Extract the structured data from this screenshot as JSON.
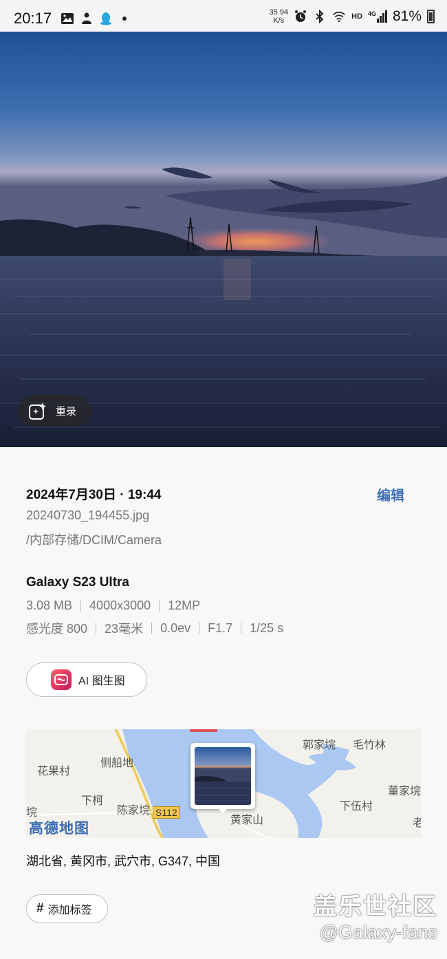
{
  "status_bar": {
    "time": "20:17",
    "net_speed_value": "35.94",
    "net_speed_unit": "K/s",
    "network": "HD",
    "signal": "4G",
    "battery": "81%",
    "icons": [
      "gallery-icon",
      "person-icon",
      "qq-icon",
      "alarm-icon",
      "bluetooth-icon",
      "wifi-icon",
      "signal-icon",
      "battery-icon"
    ]
  },
  "photo": {
    "remaster_label": "重录"
  },
  "details": {
    "datetime": "2024年7月30日 · 19:44",
    "edit_label": "编辑",
    "filename": "20240730_194455.jpg",
    "path": "/内部存储/DCIM/Camera",
    "device": "Galaxy S23 Ultra",
    "specs_row1": [
      "3.08 MB",
      "4000x3000",
      "12MP"
    ],
    "specs_row2": [
      "感光度 800",
      "23毫米",
      "0.0ev",
      "F1.7",
      "1/25 s"
    ],
    "ai_button_label": "AI 图生图"
  },
  "map": {
    "brand": "高德地图",
    "labels": [
      "花果村",
      "侧船地",
      "下柯",
      "陈家垸",
      "郭家垸",
      "毛竹林",
      "董家垸",
      "下伍村",
      "黄家山",
      "垸",
      "老"
    ],
    "road": "S112"
  },
  "location": {
    "address": "湖北省, 黄冈市, 武穴市, G347, 中国"
  },
  "tags": {
    "add_label": "添加标签"
  },
  "watermark": {
    "line1": "盖乐世社区",
    "line2": "@Galaxy-fans"
  }
}
